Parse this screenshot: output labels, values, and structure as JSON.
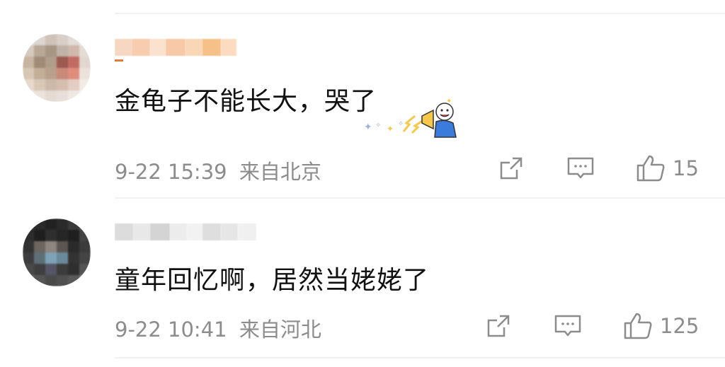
{
  "comments": [
    {
      "text": "金龟子不能长大，哭了",
      "date": "9-22 15:39",
      "location": "来自北京",
      "like_count": "15",
      "icons": [
        "share-icon",
        "comment-icon",
        "like-icon"
      ],
      "has_sticker": true
    },
    {
      "text": "童年回忆啊，居然当姥姥了",
      "date": "9-22 10:41",
      "location": "来自河北",
      "like_count": "125",
      "icons": [
        "share-icon",
        "comment-icon",
        "like-icon"
      ],
      "has_sticker": false
    }
  ],
  "colors": {
    "text": "#111111",
    "meta": "#8c8c8c",
    "divider": "#f1f1f1",
    "sticker_blue": "#3b7bdc",
    "sticker_yellow": "#f5c84a"
  }
}
